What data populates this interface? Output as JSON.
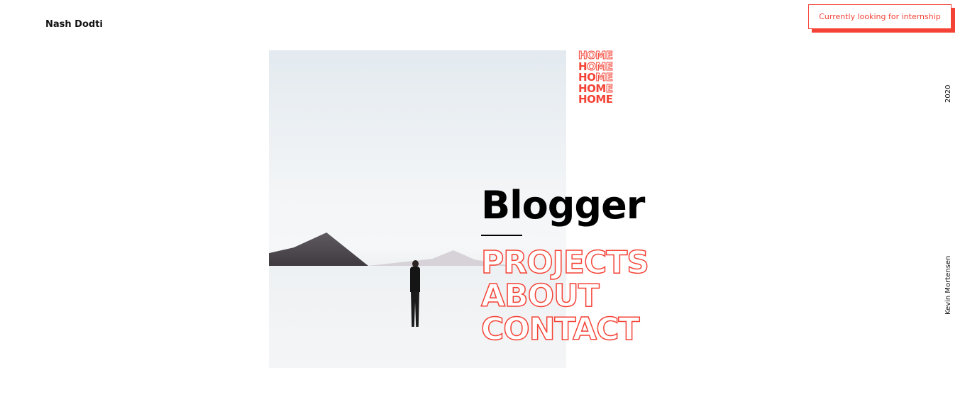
{
  "header": {
    "brand": "Nash Dodti",
    "cta_label": "Currently looking for internship"
  },
  "logo": {
    "word": "HOME",
    "rows": 5,
    "accent_color": "#f44336"
  },
  "hero": {
    "title": "Blogger",
    "nav": [
      {
        "label": "PROJECTS"
      },
      {
        "label": "ABOUT"
      },
      {
        "label": "CONTACT"
      }
    ]
  },
  "side": {
    "year": "2020",
    "credit": "Kevin Mortensen"
  }
}
